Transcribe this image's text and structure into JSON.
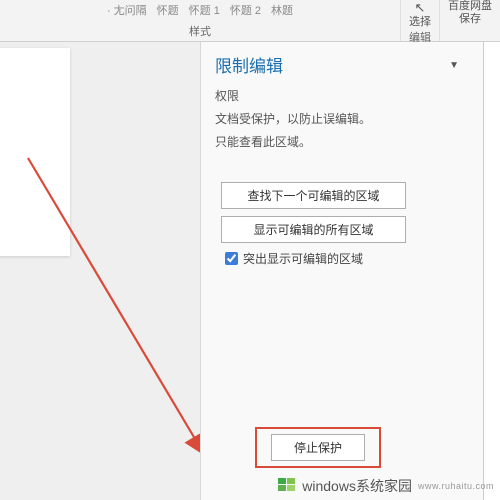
{
  "ribbon": {
    "styles_items": [
      "· 尢问隔",
      "怀题",
      "怀题 1",
      "怀题 2",
      "林题"
    ],
    "styles_label": "样式",
    "editing_items": [
      "选择"
    ],
    "editing_label": "编辑",
    "baidu_label": "百度网盘",
    "baidu_sub": "保存"
  },
  "panel": {
    "title": "限制编辑",
    "section": "权限",
    "line1": "文档受保护，以防止误编辑。",
    "line2": "只能查看此区域。",
    "btn_find_next": "查找下一个可编辑的区域",
    "btn_show_all": "显示可编辑的所有区域",
    "checkbox_label": "突出显示可编辑的区域",
    "checkbox_checked": true,
    "stop_protect": "停止保护"
  },
  "watermark": {
    "brand": "windows系统家园",
    "url": "www.ruhaitu.com"
  }
}
